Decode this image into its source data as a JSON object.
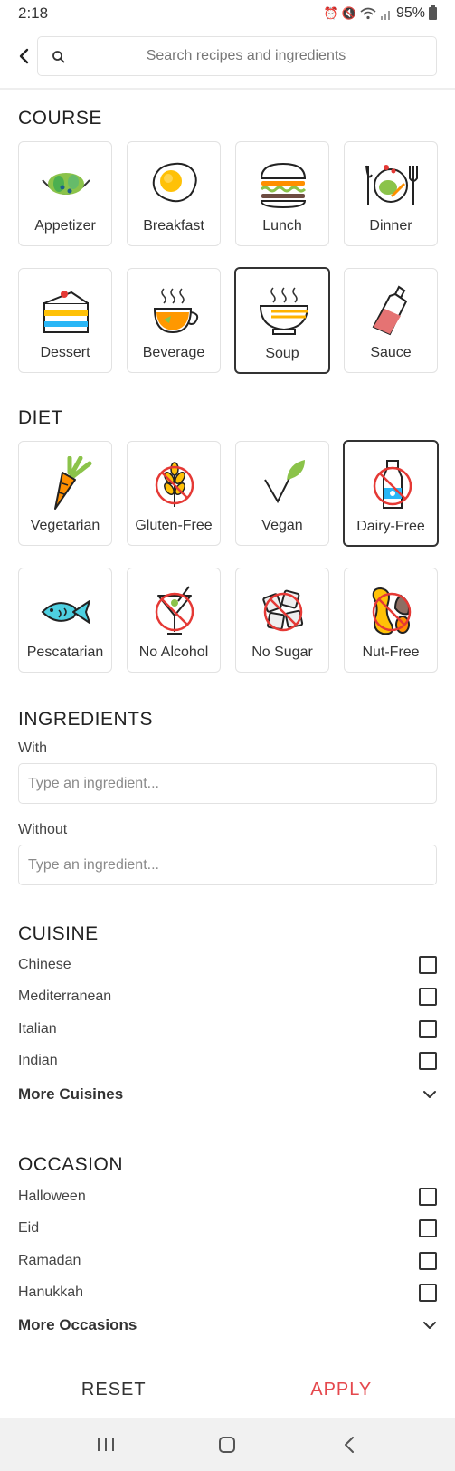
{
  "status_bar": {
    "time": "2:18",
    "battery": "95%"
  },
  "search": {
    "placeholder": "Search recipes and ingredients"
  },
  "course": {
    "title": "COURSE",
    "items": [
      {
        "label": "Appetizer",
        "icon": "salad-bowl-icon",
        "selected": false
      },
      {
        "label": "Breakfast",
        "icon": "fried-egg-icon",
        "selected": false
      },
      {
        "label": "Lunch",
        "icon": "burger-icon",
        "selected": false
      },
      {
        "label": "Dinner",
        "icon": "dinner-plate-icon",
        "selected": false
      },
      {
        "label": "Dessert",
        "icon": "cake-slice-icon",
        "selected": false
      },
      {
        "label": "Beverage",
        "icon": "tea-cup-icon",
        "selected": false
      },
      {
        "label": "Soup",
        "icon": "soup-bowl-icon",
        "selected": true
      },
      {
        "label": "Sauce",
        "icon": "sauce-bottle-icon",
        "selected": false
      }
    ]
  },
  "diet": {
    "title": "DIET",
    "items": [
      {
        "label": "Vegetarian",
        "icon": "carrot-icon",
        "selected": false
      },
      {
        "label": "Gluten-Free",
        "icon": "no-wheat-icon",
        "selected": false
      },
      {
        "label": "Vegan",
        "icon": "vegan-leaf-icon",
        "selected": false
      },
      {
        "label": "Dairy-Free",
        "icon": "no-milk-icon",
        "selected": true
      },
      {
        "label": "Pescatarian",
        "icon": "fish-icon",
        "selected": false
      },
      {
        "label": "No Alcohol",
        "icon": "no-cocktail-icon",
        "selected": false
      },
      {
        "label": "No Sugar",
        "icon": "no-sugar-cubes-icon",
        "selected": false
      },
      {
        "label": "Nut-Free",
        "icon": "no-nuts-icon",
        "selected": false
      }
    ]
  },
  "ingredients": {
    "title": "INGREDIENTS",
    "with_label": "With",
    "with_placeholder": "Type an ingredient...",
    "without_label": "Without",
    "without_placeholder": "Type an ingredient..."
  },
  "cuisine": {
    "title": "CUISINE",
    "options": [
      {
        "label": "Chinese",
        "checked": false
      },
      {
        "label": "Mediterranean",
        "checked": false
      },
      {
        "label": "Italian",
        "checked": false
      },
      {
        "label": "Indian",
        "checked": false
      }
    ],
    "more_label": "More Cuisines"
  },
  "occasion": {
    "title": "OCCASION",
    "options": [
      {
        "label": "Halloween",
        "checked": false
      },
      {
        "label": "Eid",
        "checked": false
      },
      {
        "label": "Ramadan",
        "checked": false
      },
      {
        "label": "Hanukkah",
        "checked": false
      }
    ],
    "more_label": "More Occasions"
  },
  "actions": {
    "reset_label": "RESET",
    "apply_label": "APPLY"
  },
  "colors": {
    "accent": "#e5484d",
    "selected_border": "#333333",
    "tile_border": "#e2e2e2"
  }
}
